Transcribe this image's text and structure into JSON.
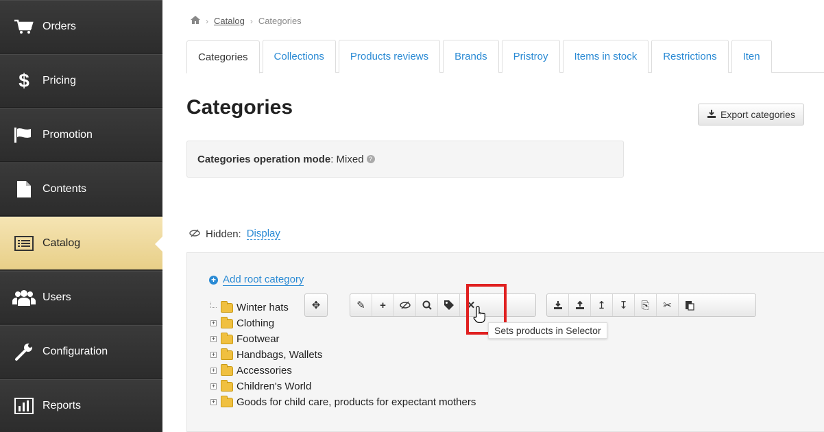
{
  "sidebar": {
    "items": [
      {
        "label": "Orders",
        "icon": "cart-icon",
        "active": false
      },
      {
        "label": "Pricing",
        "icon": "dollar-icon",
        "active": false
      },
      {
        "label": "Promotion",
        "icon": "flag-icon",
        "active": false
      },
      {
        "label": "Contents",
        "icon": "document-icon",
        "active": false
      },
      {
        "label": "Catalog",
        "icon": "list-icon",
        "active": true
      },
      {
        "label": "Users",
        "icon": "users-icon",
        "active": false
      },
      {
        "label": "Configuration",
        "icon": "wrench-icon",
        "active": false
      },
      {
        "label": "Reports",
        "icon": "bar-chart-icon",
        "active": false
      }
    ]
  },
  "breadcrumb": {
    "home_icon": "home-icon",
    "link": "Catalog",
    "current": "Categories",
    "separator": "›"
  },
  "tabs": [
    {
      "label": "Categories",
      "active": true
    },
    {
      "label": "Collections"
    },
    {
      "label": "Products reviews"
    },
    {
      "label": "Brands"
    },
    {
      "label": "Pristroy"
    },
    {
      "label": "Items in stock"
    },
    {
      "label": "Restrictions"
    },
    {
      "label": "Iten"
    }
  ],
  "page": {
    "title": "Categories",
    "export_label": "Export categories",
    "mode_label": "Categories operation mode",
    "mode_value": ": Mixed",
    "hidden_label": "Hidden:",
    "hidden_link": "Display",
    "add_root": "Add root category"
  },
  "tree": {
    "nodes": [
      "Winter hats",
      "Clothing",
      "Footwear",
      "Handbags, Wallets",
      "Accessories",
      "Children's World",
      "Goods for child care, products for expectant mothers"
    ]
  },
  "tooltip": "Sets products in Selector",
  "colors": {
    "accent": "#2a8ad4",
    "highlight": "#e02020",
    "sidebar": "#2f2f2f",
    "active_item": "#f0dc9e"
  }
}
